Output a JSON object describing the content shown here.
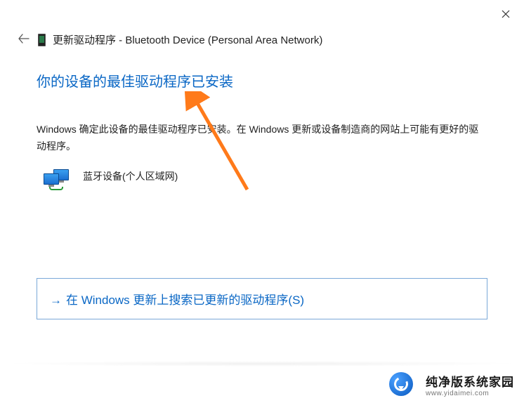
{
  "header": {
    "title_prefix": "更新驱动程序",
    "title_sep": " - ",
    "title_device": "Bluetooth Device (Personal Area Network)"
  },
  "main": {
    "heading": "你的设备的最佳驱动程序已安装",
    "description": "Windows 确定此设备的最佳驱动程序已安装。在 Windows 更新或设备制造商的网站上可能有更好的驱动程序。",
    "device_label": "蓝牙设备(个人区域网)"
  },
  "action": {
    "arrow": "→",
    "label": "在 Windows 更新上搜索已更新的驱动程序(S)"
  },
  "watermark": {
    "brand": "纯净版系统家园",
    "url": "www.yidaimei.com"
  }
}
